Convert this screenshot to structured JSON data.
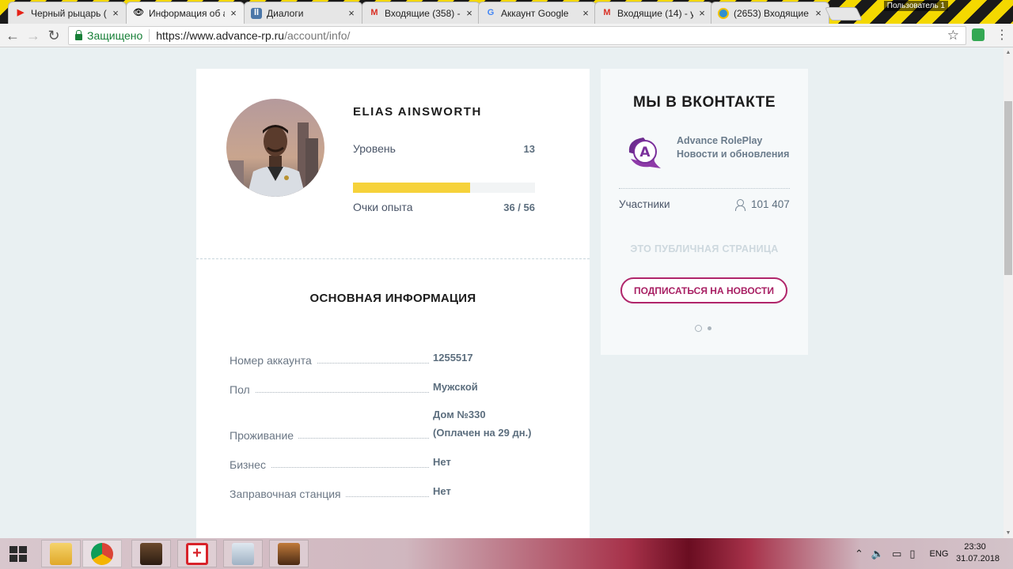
{
  "browser": {
    "tabs": [
      {
        "title": "Черный рыцарь (",
        "favicon": "youtube-icon"
      },
      {
        "title": "Информация об а",
        "favicon": "eye-icon",
        "active": true
      },
      {
        "title": "Диалоги",
        "favicon": "vk-icon"
      },
      {
        "title": "Входящие (358) -",
        "favicon": "gmail-icon"
      },
      {
        "title": "Аккаунт Google",
        "favicon": "google-icon"
      },
      {
        "title": "Входящие (14) - у",
        "favicon": "gmail-icon"
      },
      {
        "title": "(2653) Входящие",
        "favicon": "chat-icon"
      }
    ],
    "close_glyph": "×",
    "profile_badge": "Пользователь 1",
    "secure_label": "Защищено",
    "url_host": "https://www.advance-rp.ru",
    "url_path": "/account/info/",
    "accent_color": "#188038"
  },
  "profile": {
    "name": "ELIAS AINSWORTH",
    "level_label": "Уровень",
    "level_value": "13",
    "xp_label": "Очки опыта",
    "xp_value": "36 / 56",
    "xp_fraction": 0.643,
    "xp_bar_color": "#f6d23a"
  },
  "basic_info": {
    "title": "ОСНОВНАЯ ИНФОРМАЦИЯ",
    "rows": [
      {
        "label": "Номер аккаунта",
        "value": "1255517"
      },
      {
        "label": "Пол",
        "value": "Мужской"
      },
      {
        "label": "Проживание",
        "value": "Дом №330",
        "value2": "(Оплачен на 29 дн.)"
      },
      {
        "label": "Бизнес",
        "value": "Нет"
      },
      {
        "label": "Заправочная станция",
        "value": "Нет"
      }
    ]
  },
  "vk_widget": {
    "title": "МЫ В ВКОНТАКТЕ",
    "logo_letter": "A",
    "group_name": "Advance RolePlay",
    "group_subtitle": "Новости и обновления",
    "members_label": "Участники",
    "members_count": "101 407",
    "public_note": "ЭТО ПУБЛИЧНАЯ СТРАНИЦА",
    "subscribe_label": "ПОДПИСАТЬСЯ НА НОВОСТИ",
    "brand_color": "#a81f63"
  },
  "taskbar": {
    "apps": [
      "file-explorer-icon",
      "chrome-icon",
      "game-icon",
      "red-cross-icon",
      "monitor-icon",
      "game-icon"
    ],
    "language": "ENG",
    "time": "23:30",
    "date": "31.07.2018"
  }
}
